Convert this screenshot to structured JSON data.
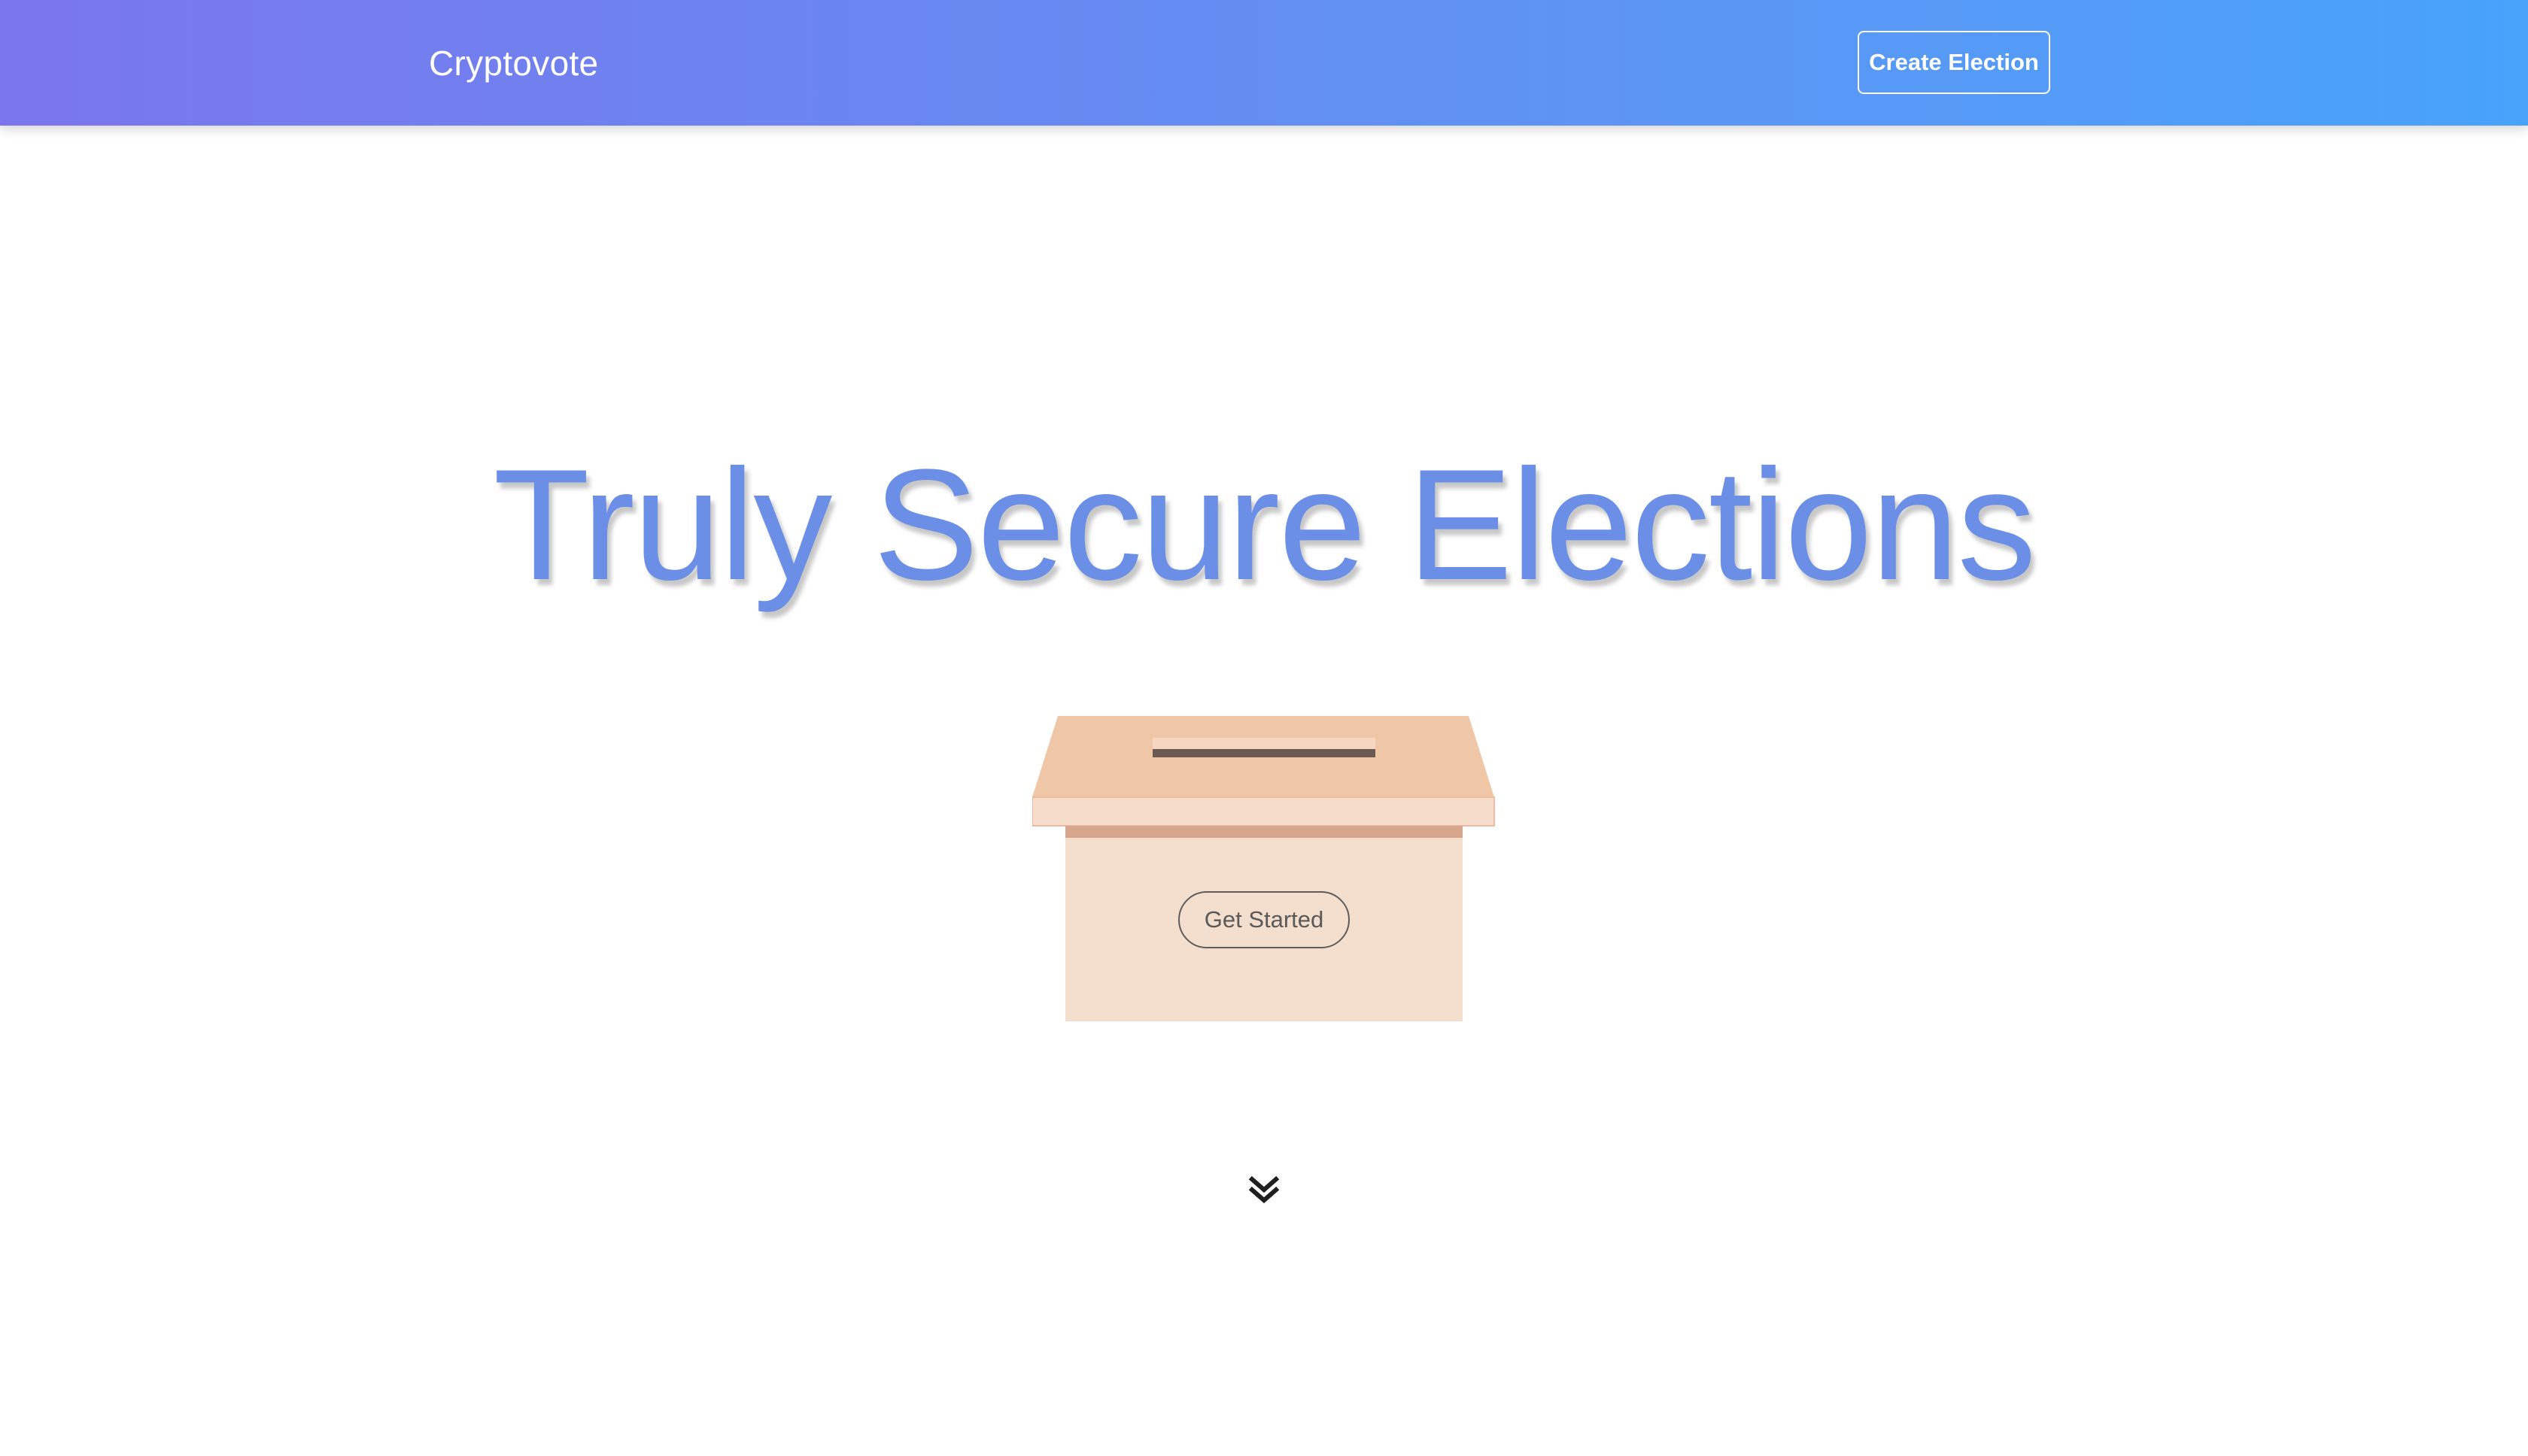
{
  "navbar": {
    "brand": "Cryptovote",
    "create_election_label": "Create Election"
  },
  "hero": {
    "title": "Truly Secure Elections",
    "cta_label": "Get Started",
    "scroll_icon": "double-chevron-down-icon"
  },
  "colors": {
    "gradient_start": "#7b76ee",
    "gradient_end": "#48a3fb",
    "title_color": "#6b8fe6",
    "ballot_lid": "#f0c7a6",
    "ballot_body": "#f4dfcf",
    "ballot_slot": "#6b5a52"
  }
}
